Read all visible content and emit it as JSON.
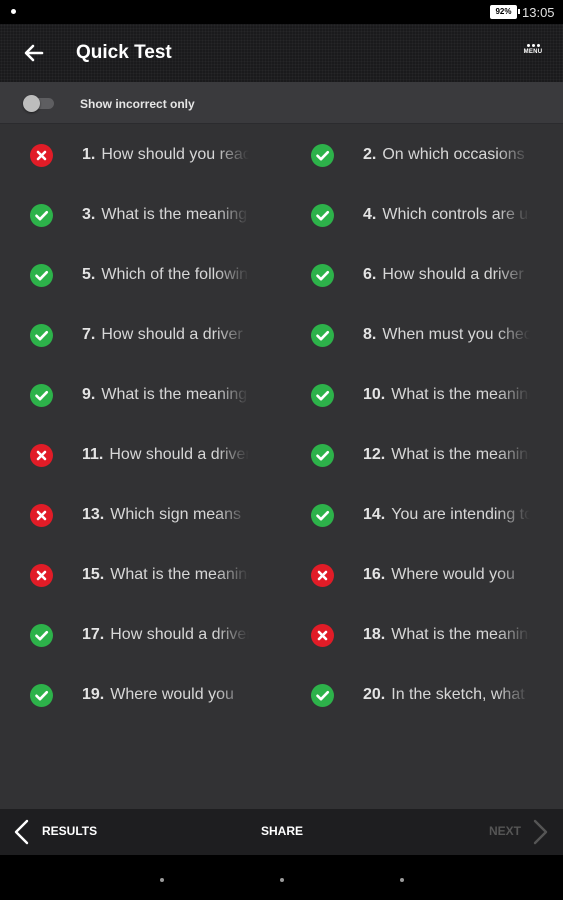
{
  "status_bar": {
    "battery": "92%",
    "time": "13:05"
  },
  "app_bar": {
    "title": "Quick Test",
    "back_icon": "arrow-left-icon",
    "menu_icon": "menu-dots-icon",
    "menu_label": "MENU"
  },
  "filter": {
    "label": "Show incorrect only",
    "enabled": false
  },
  "questions": [
    {
      "num": "1.",
      "text": "How should you react when the",
      "result": "incorrect"
    },
    {
      "num": "2.",
      "text": "On which occasions must",
      "result": "correct"
    },
    {
      "num": "3.",
      "text": "What is the meaning of",
      "result": "correct"
    },
    {
      "num": "4.",
      "text": "Which controls are used",
      "result": "correct"
    },
    {
      "num": "5.",
      "text": "Which of the following",
      "result": "correct"
    },
    {
      "num": "6.",
      "text": "How should a driver",
      "result": "correct"
    },
    {
      "num": "7.",
      "text": "How should a driver",
      "result": "correct"
    },
    {
      "num": "8.",
      "text": "When must you check",
      "result": "correct"
    },
    {
      "num": "9.",
      "text": "What is the meaning of",
      "result": "correct"
    },
    {
      "num": "10.",
      "text": "What is the meaning",
      "result": "correct"
    },
    {
      "num": "11.",
      "text": "How should a driver",
      "result": "incorrect"
    },
    {
      "num": "12.",
      "text": "What is the meaning",
      "result": "correct"
    },
    {
      "num": "13.",
      "text": "Which sign means",
      "result": "incorrect"
    },
    {
      "num": "14.",
      "text": "You are intending to",
      "result": "correct"
    },
    {
      "num": "15.",
      "text": "What is the meaning",
      "result": "incorrect"
    },
    {
      "num": "16.",
      "text": "Where would you",
      "result": "incorrect"
    },
    {
      "num": "17.",
      "text": "How should a driver",
      "result": "correct"
    },
    {
      "num": "18.",
      "text": "What is the meaning",
      "result": "incorrect"
    },
    {
      "num": "19.",
      "text": "Where would you",
      "result": "correct"
    },
    {
      "num": "20.",
      "text": "In the sketch, what",
      "result": "correct"
    }
  ],
  "bottom_bar": {
    "results_label": "RESULTS",
    "share_label": "SHARE",
    "next_label": "NEXT"
  },
  "colors": {
    "correct": "#2db24a",
    "incorrect": "#e11c27",
    "background": "#323234"
  }
}
